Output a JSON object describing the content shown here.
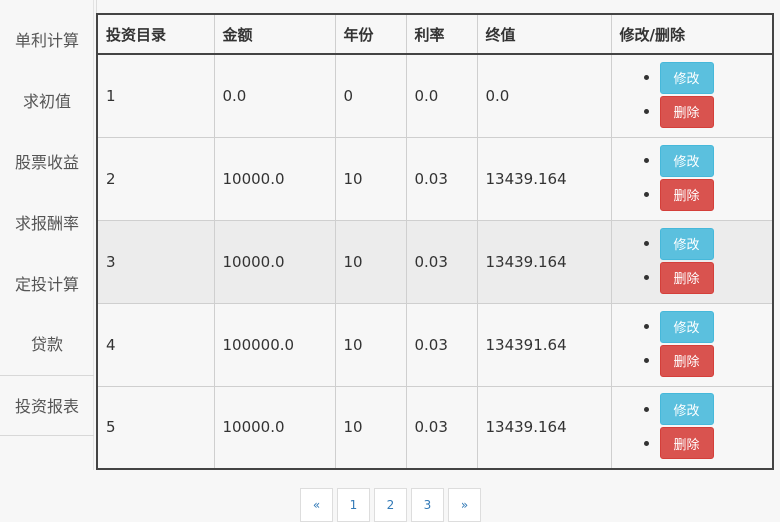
{
  "sidebar": {
    "items": [
      {
        "label": "单利计算"
      },
      {
        "label": "求初值"
      },
      {
        "label": "股票收益"
      },
      {
        "label": "求报酬率"
      },
      {
        "label": "定投计算"
      },
      {
        "label": "贷款"
      },
      {
        "label": "投资报表"
      }
    ]
  },
  "table": {
    "headers": [
      "投资目录",
      "金额",
      "年份",
      "利率",
      "终值",
      "修改/删除"
    ],
    "rows": [
      {
        "id": "1",
        "amount": "0.0",
        "years": "0",
        "rate": "0.0",
        "final": "0.0"
      },
      {
        "id": "2",
        "amount": "10000.0",
        "years": "10",
        "rate": "0.03",
        "final": "13439.164"
      },
      {
        "id": "3",
        "amount": "10000.0",
        "years": "10",
        "rate": "0.03",
        "final": "13439.164"
      },
      {
        "id": "4",
        "amount": "100000.0",
        "years": "10",
        "rate": "0.03",
        "final": "134391.64"
      },
      {
        "id": "5",
        "amount": "10000.0",
        "years": "10",
        "rate": "0.03",
        "final": "13439.164"
      }
    ],
    "edit_label": "修改",
    "delete_label": "删除"
  },
  "pagination": {
    "prev": "«",
    "pages": [
      "1",
      "2",
      "3"
    ],
    "next": "»"
  },
  "colors": {
    "edit_button": "#5bc0de",
    "delete_button": "#d9534f",
    "link": "#337ab7"
  }
}
